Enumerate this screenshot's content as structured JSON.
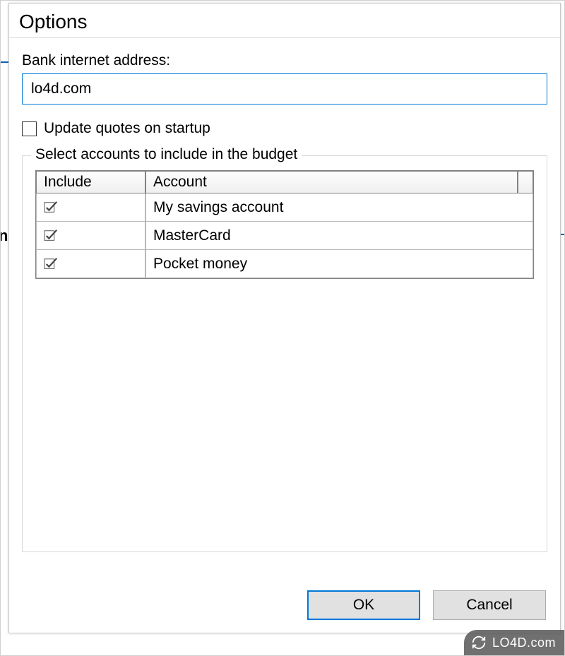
{
  "dialog": {
    "title": "Options",
    "address_label": "Bank internet address:",
    "address_value": "lo4d.com",
    "update_checkbox_label": "Update quotes on startup",
    "update_checkbox_checked": false,
    "groupbox_legend": "Select accounts to include in the budget",
    "table": {
      "headers": {
        "include": "Include",
        "account": "Account"
      },
      "rows": [
        {
          "checked": true,
          "account": "My savings account"
        },
        {
          "checked": true,
          "account": "MasterCard"
        },
        {
          "checked": true,
          "account": "Pocket money"
        }
      ]
    },
    "buttons": {
      "ok": "OK",
      "cancel": "Cancel"
    }
  },
  "watermark": "LO4D.com"
}
